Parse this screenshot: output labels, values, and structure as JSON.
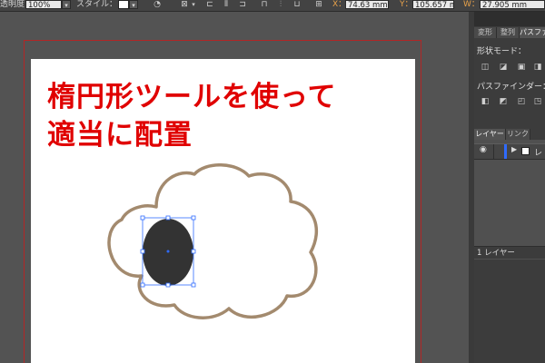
{
  "control_bar": {
    "opacity_label": "透明度：",
    "opacity_value": "100%",
    "style_label": "スタイル：",
    "x_label": "X：",
    "x_value": "74.63 mm",
    "y_label": "Y：",
    "y_value": "105.657 m",
    "w_label": "W：",
    "w_value": "27.905 mm"
  },
  "artboard": {
    "heading_line1": "楕円形ツールを使って",
    "heading_line2": "適当に配置",
    "heading_color": "#e00000"
  },
  "illustration": {
    "cloud_stroke": "#a38a6e",
    "ellipse_fill": "#333333",
    "selection_color": "#2f6bff"
  },
  "panels": {
    "tabs": [
      "変形",
      "整列",
      "パスファ"
    ],
    "shape_modes_title": "形状モード：",
    "pathfinder_title": "パスファインダー：",
    "layer_tabs": [
      "レイヤー",
      "リンク"
    ],
    "layer_name": "レ",
    "layer_count": "1 レイヤー"
  },
  "colors": {
    "workspace": "#535353",
    "panel": "#3c3c3c",
    "artboard_border": "#b32626"
  }
}
